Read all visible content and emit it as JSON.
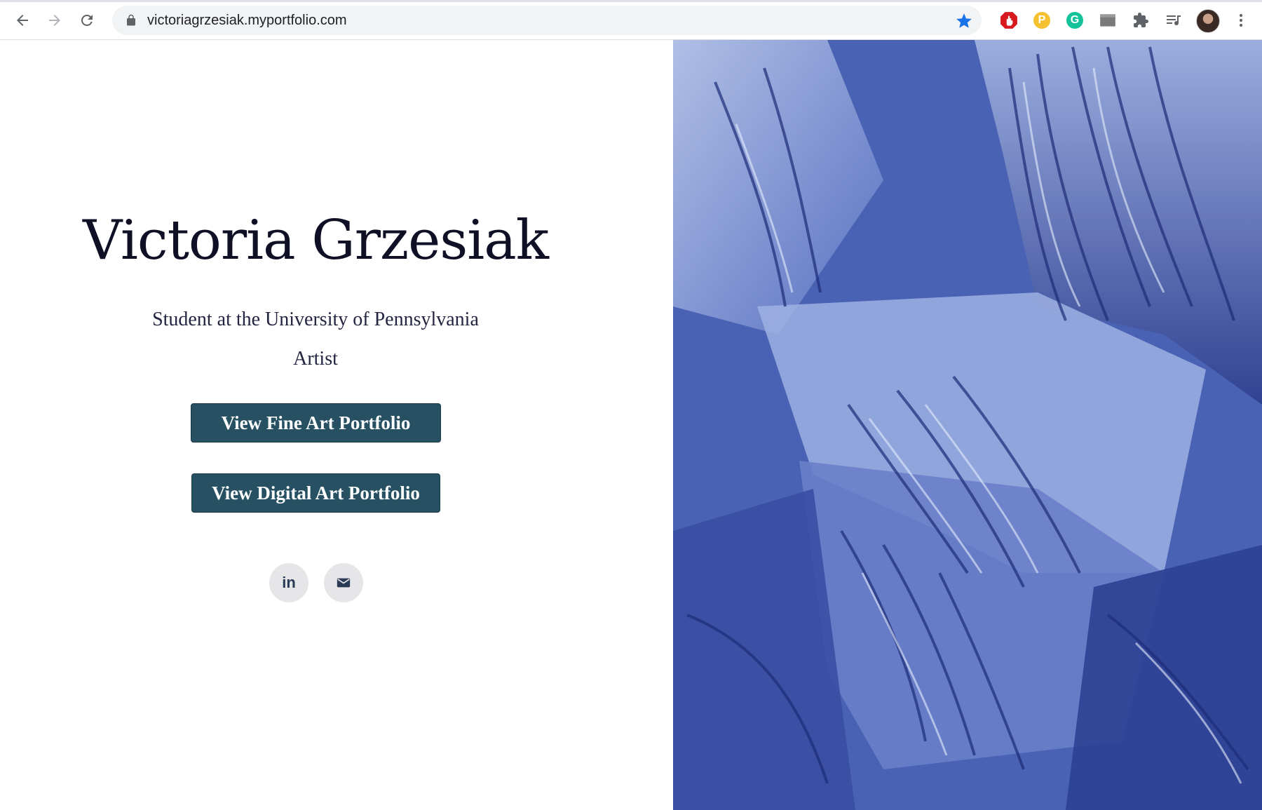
{
  "browser": {
    "url": "victoriagrzesiak.myportfolio.com",
    "icons": {
      "back": "back-arrow-icon",
      "forward": "forward-arrow-icon",
      "reload": "reload-icon",
      "lock": "lock-icon",
      "bookmark": "star-icon",
      "extensions": [
        "adblock-icon",
        "honey-p-icon",
        "grammarly-g-icon",
        "screen-cast-icon",
        "puzzle-extensions-icon",
        "media-queue-icon"
      ],
      "profile": "profile-avatar",
      "menu": "kebab-menu-icon"
    },
    "extension_letters": {
      "honey": "P",
      "grammarly": "G"
    },
    "colors": {
      "star": "#1a73e8",
      "adblock": "#d7191f",
      "honey": "#f5c131",
      "grammarly": "#15c39a"
    }
  },
  "hero": {
    "name": "Victoria Grzesiak",
    "subtitle_line1": "Student at the University of Pennsylvania",
    "subtitle_line2": "Artist",
    "buttons": {
      "fine_art": "View Fine Art Portfolio",
      "digital_art": "View Digital Art Portfolio"
    },
    "social": {
      "linkedin_text": "in",
      "linkedin_icon": "linkedin-icon",
      "email_icon": "mail-icon"
    },
    "colors": {
      "button_bg": "#275163",
      "name_text": "#0f1026"
    }
  },
  "artwork": {
    "subject": "blue watercolor painting of draped classical sculpture"
  }
}
